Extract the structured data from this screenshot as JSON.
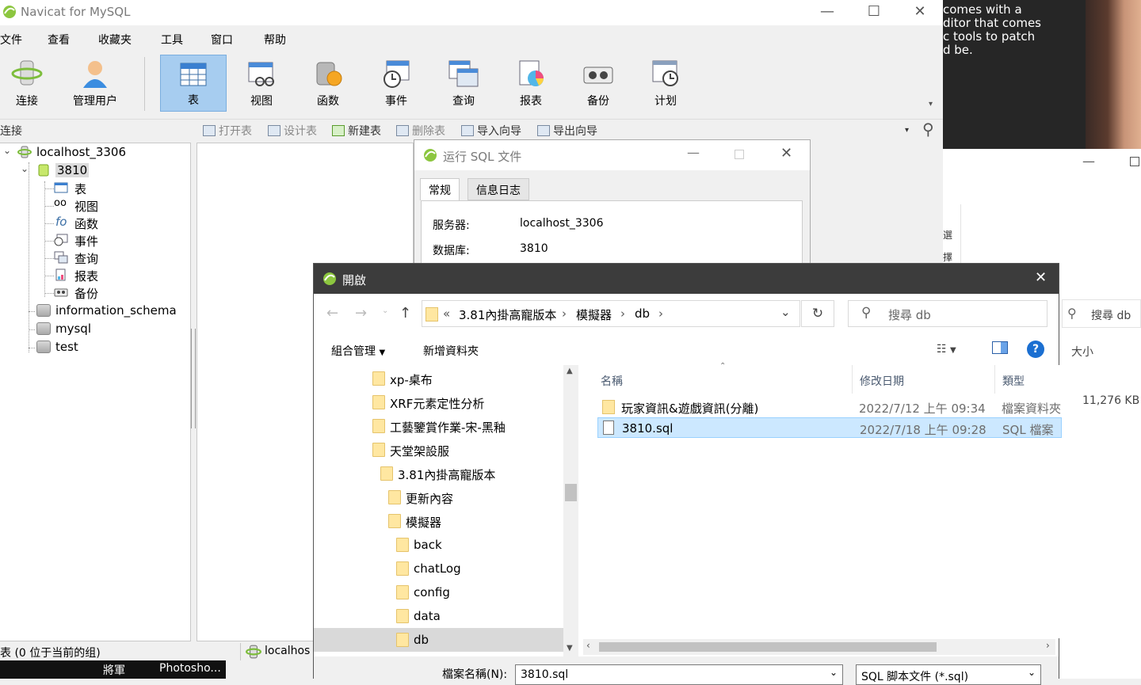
{
  "navicat": {
    "title": "Navicat for MySQL",
    "menu": [
      "文件",
      "查看",
      "收藏夹",
      "工具",
      "窗口",
      "帮助"
    ],
    "toolbar": [
      {
        "label": "连接",
        "icon": "connection-icon"
      },
      {
        "label": "管理用户",
        "icon": "user-icon"
      },
      {
        "label": "表",
        "icon": "table-icon",
        "active": true
      },
      {
        "label": "视图",
        "icon": "view-icon"
      },
      {
        "label": "函数",
        "icon": "function-icon"
      },
      {
        "label": "事件",
        "icon": "event-icon"
      },
      {
        "label": "查询",
        "icon": "query-icon"
      },
      {
        "label": "报表",
        "icon": "report-icon"
      },
      {
        "label": "备份",
        "icon": "backup-icon"
      },
      {
        "label": "计划",
        "icon": "schedule-icon"
      }
    ],
    "subbar_left": "连接",
    "subbar": [
      "打开表",
      "设计表",
      "新建表",
      "删除表",
      "导入向导",
      "导出向导"
    ],
    "tree": {
      "connection": "localhost_3306",
      "selected_db": "3810",
      "children": [
        "表",
        "视图",
        "函数",
        "事件",
        "查询",
        "报表",
        "备份"
      ],
      "other_dbs": [
        "information_schema",
        "mysql",
        "test"
      ]
    },
    "status_left": "表 (0 位于当前的组)",
    "status_conn": "localhos"
  },
  "taskbar": {
    "items": [
      "將軍",
      "Photosho..."
    ]
  },
  "background": {
    "text_lines": [
      "comes with a",
      "ditor that comes",
      "c tools to patch",
      "d be."
    ],
    "search_placeholder": "搜尋 db",
    "col_size": "大小",
    "size_value": "11,276 KB",
    "side_chars": [
      "選",
      "擇"
    ]
  },
  "run_sql": {
    "title": "运行 SQL 文件",
    "tabs": [
      "常规",
      "信息日志"
    ],
    "server_label": "服务器:",
    "server_value": "localhost_3306",
    "db_label": "数据库:",
    "db_value": "3810"
  },
  "open_dialog": {
    "title": "開啟",
    "breadcrumb": [
      "«",
      "3.81內掛高寵版本",
      "模擬器",
      "db"
    ],
    "search_placeholder": "搜尋 db",
    "organize": "組合管理",
    "new_folder": "新增資料夾",
    "folders": [
      "xp-桌布",
      "XRF元素定性分析",
      "工藝鑒賞作業-宋-黑釉",
      "天堂架設服",
      "3.81內掛高寵版本",
      "更新內容",
      "模擬器",
      "back",
      "chatLog",
      "config",
      "data",
      "db"
    ],
    "columns": {
      "name": "名稱",
      "date": "修改日期",
      "type": "類型"
    },
    "files": [
      {
        "name": "玩家資訊&遊戲資訊(分離)",
        "date": "2022/7/12 上午 09:34",
        "type": "檔案資料夾",
        "kind": "folder"
      },
      {
        "name": "3810.sql",
        "date": "2022/7/18 上午 09:28",
        "type": "SQL 檔案",
        "kind": "file"
      }
    ],
    "filename_label": "檔案名稱(N):",
    "filename_value": "3810.sql",
    "filter": "SQL 脚本文件 (*.sql)"
  }
}
